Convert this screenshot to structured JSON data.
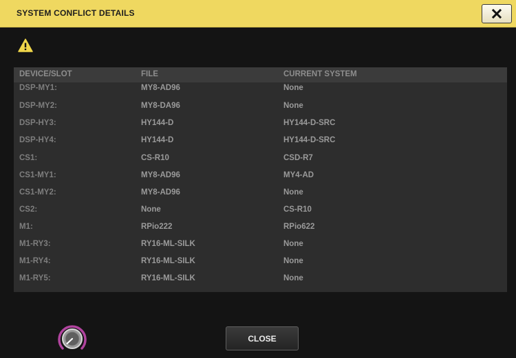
{
  "dialog": {
    "title": "SYSTEM CONFLICT DETAILS",
    "close_icon": "close-x-icon",
    "warning_icon": "warning-triangle-icon"
  },
  "table": {
    "headers": {
      "device_slot": "DEVICE/SLOT",
      "file": "FILE",
      "current_system": "CURRENT SYSTEM"
    },
    "rows": [
      {
        "device": "DSP-MY1:",
        "file": "MY8-AD96",
        "current": "None"
      },
      {
        "device": "DSP-MY2:",
        "file": "MY8-DA96",
        "current": "None"
      },
      {
        "device": "DSP-HY3:",
        "file": "HY144-D",
        "current": "HY144-D-SRC"
      },
      {
        "device": "DSP-HY4:",
        "file": "HY144-D",
        "current": "HY144-D-SRC"
      },
      {
        "device": "CS1:",
        "file": "CS-R10",
        "current": "CSD-R7"
      },
      {
        "device": "CS1-MY1:",
        "file": "MY8-AD96",
        "current": "MY4-AD"
      },
      {
        "device": "CS1-MY2:",
        "file": "MY8-AD96",
        "current": "None"
      },
      {
        "device": "CS2:",
        "file": "None",
        "current": "CS-R10"
      },
      {
        "device": "M1:",
        "file": "RPio222",
        "current": "RPio622"
      },
      {
        "device": "M1-RY3:",
        "file": "RY16-ML-SILK",
        "current": "None"
      },
      {
        "device": "M1-RY4:",
        "file": "RY16-ML-SILK",
        "current": "None"
      },
      {
        "device": "M1-RY5:",
        "file": "RY16-ML-SILK",
        "current": "None"
      }
    ]
  },
  "footer": {
    "close_label": "CLOSE",
    "knob_icon": "rotary-knob-icon",
    "knob_accent_color": "#b0449e"
  },
  "colors": {
    "titlebar": "#efd860",
    "background": "#141414",
    "table_panel": "#2d2d2d",
    "table_header": "#3b3b3b"
  }
}
